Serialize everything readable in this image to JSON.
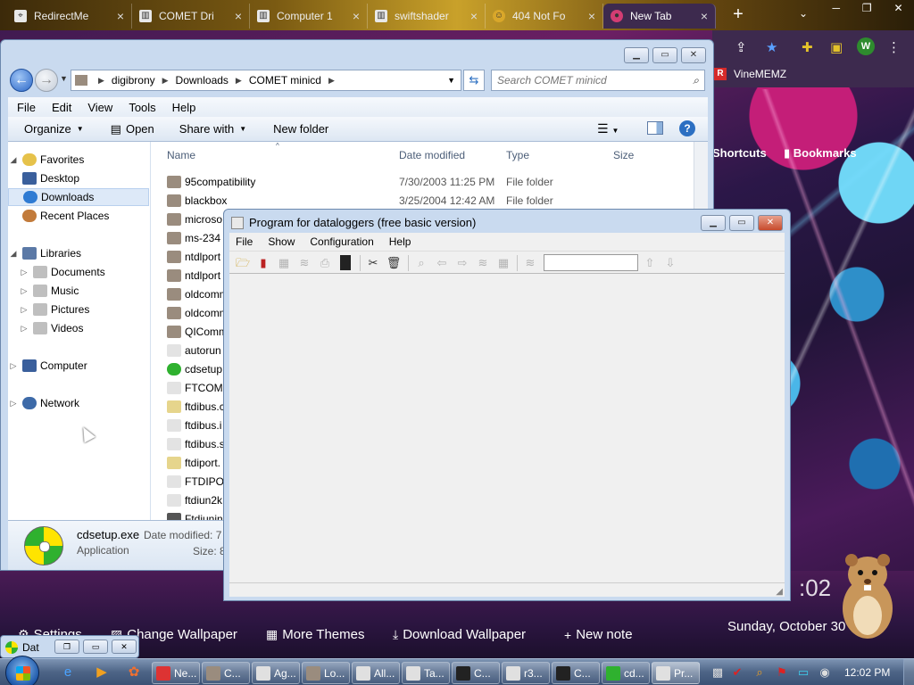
{
  "browser": {
    "tabs": [
      {
        "label": "RedirectMe",
        "icon": "crosshair-icon"
      },
      {
        "label": "COMET Dri",
        "icon": "archive-icon"
      },
      {
        "label": "Computer 1",
        "icon": "archive-icon"
      },
      {
        "label": "swiftshader",
        "icon": "archive-icon"
      },
      {
        "label": "404 Not Fo",
        "icon": "smiley-icon"
      },
      {
        "label": "New Tab",
        "icon": "chrome-icon",
        "active": true
      }
    ],
    "profile_initial": "W",
    "bookmark": "VineMEMZ",
    "shortcuts_label": "Shortcuts",
    "bookmarks_label": "Bookmarks",
    "clock_text": ":02",
    "date_text": "Sunday, October 30",
    "footer": {
      "settings": "Settings",
      "change_wallpaper": "Change Wallpaper",
      "more_themes": "More Themes",
      "download_wallpaper": "Download Wallpaper",
      "new_note": "New note"
    }
  },
  "explorer": {
    "breadcrumb": [
      "digibrony",
      "Downloads",
      "COMET minicd"
    ],
    "search_placeholder": "Search COMET minicd",
    "menu": [
      "File",
      "Edit",
      "View",
      "Tools",
      "Help"
    ],
    "commands": {
      "organize": "Organize",
      "open": "Open",
      "share_with": "Share with",
      "new_folder": "New folder"
    },
    "nav": {
      "favorites": "Favorites",
      "desktop": "Desktop",
      "downloads": "Downloads",
      "recent_places": "Recent Places",
      "libraries": "Libraries",
      "documents": "Documents",
      "music": "Music",
      "pictures": "Pictures",
      "videos": "Videos",
      "computer": "Computer",
      "network": "Network"
    },
    "columns": {
      "name": "Name",
      "date": "Date modified",
      "type": "Type",
      "size": "Size"
    },
    "files": [
      {
        "name": "95compatibility",
        "date": "7/30/2003 11:25 PM",
        "type": "File folder",
        "kind": "folder"
      },
      {
        "name": "blackbox",
        "date": "3/25/2004 12:42 AM",
        "type": "File folder",
        "kind": "folder"
      },
      {
        "name": "microso",
        "date": "",
        "type": "",
        "kind": "folder"
      },
      {
        "name": "ms-234",
        "date": "",
        "type": "",
        "kind": "folder"
      },
      {
        "name": "ntdlport",
        "date": "",
        "type": "",
        "kind": "folder"
      },
      {
        "name": "ntdlport",
        "date": "",
        "type": "",
        "kind": "folder"
      },
      {
        "name": "oldcomm",
        "date": "",
        "type": "",
        "kind": "folder"
      },
      {
        "name": "oldcomm",
        "date": "",
        "type": "",
        "kind": "folder"
      },
      {
        "name": "QIComm",
        "date": "",
        "type": "",
        "kind": "folder"
      },
      {
        "name": "autorun",
        "date": "",
        "type": "",
        "kind": "file"
      },
      {
        "name": "cdsetup",
        "date": "",
        "type": "",
        "kind": "exe"
      },
      {
        "name": "FTCOMI",
        "date": "",
        "type": "",
        "kind": "file"
      },
      {
        "name": "ftdibus.c",
        "date": "",
        "type": "",
        "kind": "cfg"
      },
      {
        "name": "ftdibus.i",
        "date": "",
        "type": "",
        "kind": "file"
      },
      {
        "name": "ftdibus.s",
        "date": "",
        "type": "",
        "kind": "file"
      },
      {
        "name": "ftdiport.",
        "date": "",
        "type": "",
        "kind": "cfg"
      },
      {
        "name": "FTDIPOR",
        "date": "",
        "type": "",
        "kind": "file"
      },
      {
        "name": "ftdiun2k",
        "date": "",
        "type": "",
        "kind": "file"
      },
      {
        "name": "Ftdiunin",
        "date": "",
        "type": "",
        "kind": "exe2"
      }
    ],
    "details": {
      "name": "cdsetup.exe",
      "type": "Application",
      "modified_label": "Date modified: 7",
      "size_label": "Size: 8"
    }
  },
  "datalogger": {
    "title": "Program for dataloggers (free basic version)",
    "menu": [
      "File",
      "Show",
      "Configuration",
      "Help"
    ]
  },
  "mini_window": {
    "label": "Dat"
  },
  "taskbar": {
    "buttons": [
      "Ne...",
      "C...",
      "Ag...",
      "Lo...",
      "All...",
      "Ta...",
      "C...",
      "r3...",
      "C...",
      "cd...",
      "Pr..."
    ],
    "clock": "12:02 PM"
  }
}
